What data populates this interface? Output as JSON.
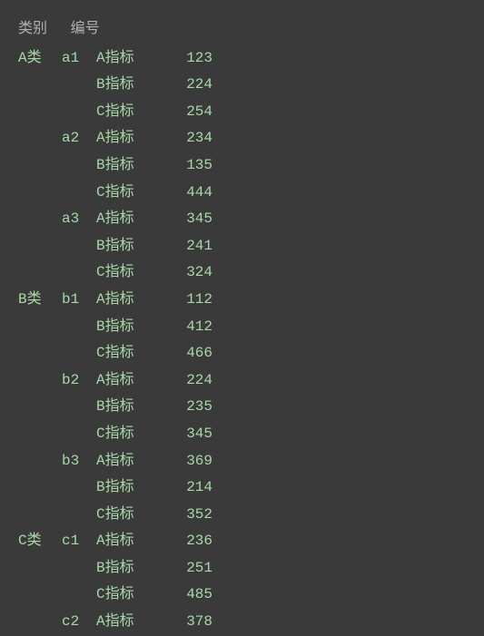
{
  "header": {
    "category": "类别",
    "id": "编号"
  },
  "rows": [
    {
      "category": "A类",
      "id": "a1",
      "metric": "A指标",
      "value": "123"
    },
    {
      "category": "",
      "id": "",
      "metric": "B指标",
      "value": "224"
    },
    {
      "category": "",
      "id": "",
      "metric": "C指标",
      "value": "254"
    },
    {
      "category": "",
      "id": "a2",
      "metric": "A指标",
      "value": "234"
    },
    {
      "category": "",
      "id": "",
      "metric": "B指标",
      "value": "135"
    },
    {
      "category": "",
      "id": "",
      "metric": "C指标",
      "value": "444"
    },
    {
      "category": "",
      "id": "a3",
      "metric": "A指标",
      "value": "345"
    },
    {
      "category": "",
      "id": "",
      "metric": "B指标",
      "value": "241"
    },
    {
      "category": "",
      "id": "",
      "metric": "C指标",
      "value": "324"
    },
    {
      "category": "B类",
      "id": "b1",
      "metric": "A指标",
      "value": "112"
    },
    {
      "category": "",
      "id": "",
      "metric": "B指标",
      "value": "412"
    },
    {
      "category": "",
      "id": "",
      "metric": "C指标",
      "value": "466"
    },
    {
      "category": "",
      "id": "b2",
      "metric": "A指标",
      "value": "224"
    },
    {
      "category": "",
      "id": "",
      "metric": "B指标",
      "value": "235"
    },
    {
      "category": "",
      "id": "",
      "metric": "C指标",
      "value": "345"
    },
    {
      "category": "",
      "id": "b3",
      "metric": "A指标",
      "value": "369"
    },
    {
      "category": "",
      "id": "",
      "metric": "B指标",
      "value": "214"
    },
    {
      "category": "",
      "id": "",
      "metric": "C指标",
      "value": "352"
    },
    {
      "category": "C类",
      "id": "c1",
      "metric": "A指标",
      "value": "236"
    },
    {
      "category": "",
      "id": "",
      "metric": "B指标",
      "value": "251"
    },
    {
      "category": "",
      "id": "",
      "metric": "C指标",
      "value": "485"
    },
    {
      "category": "",
      "id": "c2",
      "metric": "A指标",
      "value": "378"
    }
  ]
}
